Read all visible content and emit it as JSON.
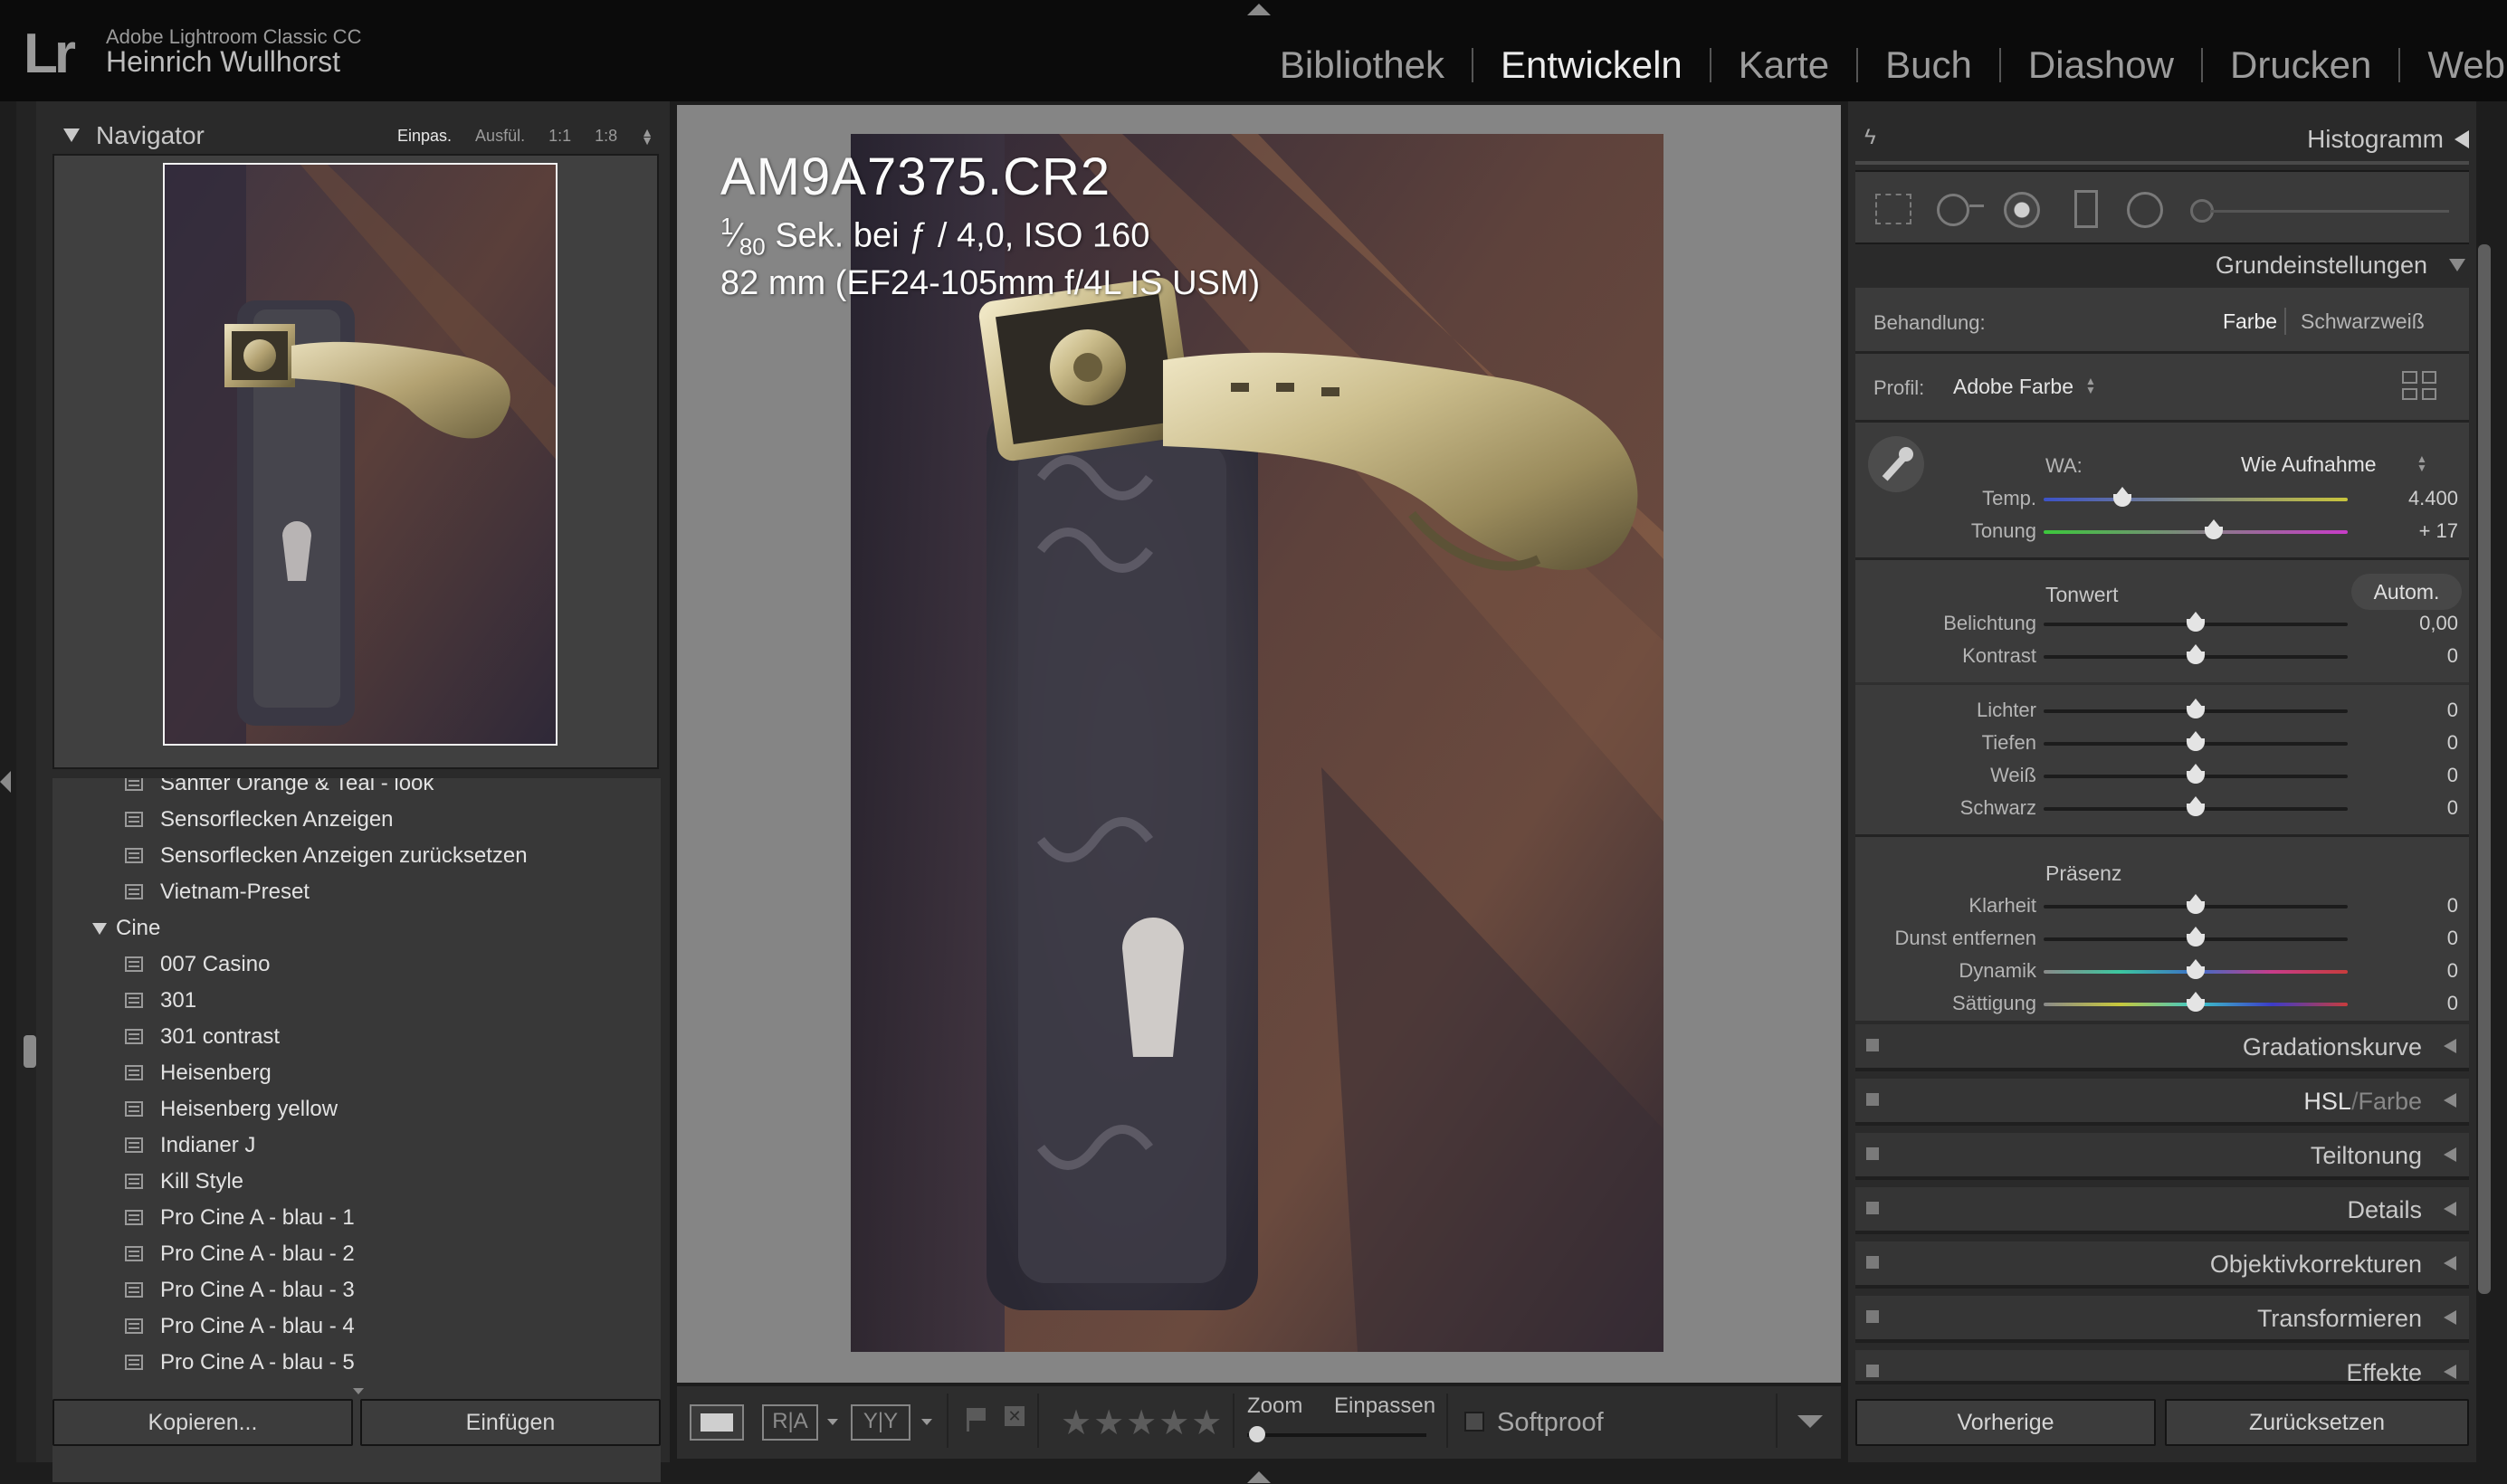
{
  "app": {
    "title": "Adobe Lightroom Classic CC",
    "user": "Heinrich Wullhorst",
    "logo": "Lr"
  },
  "modules": [
    "Bibliothek",
    "Entwickeln",
    "Karte",
    "Buch",
    "Diashow",
    "Drucken",
    "Web"
  ],
  "active_module": "Entwickeln",
  "navigator": {
    "title": "Navigator",
    "zooms": [
      "Einpas.",
      "Ausfül.",
      "1:1",
      "1:8"
    ],
    "selected_zoom": "Einpas."
  },
  "presets": {
    "items": [
      {
        "label": "Sanfter Orange & Teal - look",
        "type": "preset"
      },
      {
        "label": "Sensorflecken Anzeigen",
        "type": "preset"
      },
      {
        "label": "Sensorflecken Anzeigen zurücksetzen",
        "type": "preset"
      },
      {
        "label": "Vietnam-Preset",
        "type": "preset"
      },
      {
        "label": "Cine",
        "type": "folder"
      },
      {
        "label": "007 Casino",
        "type": "preset"
      },
      {
        "label": "301",
        "type": "preset"
      },
      {
        "label": "301 contrast",
        "type": "preset"
      },
      {
        "label": "Heisenberg",
        "type": "preset"
      },
      {
        "label": "Heisenberg yellow",
        "type": "preset"
      },
      {
        "label": "Indianer J",
        "type": "preset"
      },
      {
        "label": "Kill Style",
        "type": "preset"
      },
      {
        "label": "Pro Cine A - blau - 1",
        "type": "preset"
      },
      {
        "label": "Pro Cine A - blau - 2",
        "type": "preset"
      },
      {
        "label": "Pro Cine A - blau - 3",
        "type": "preset"
      },
      {
        "label": "Pro Cine A - blau - 4",
        "type": "preset"
      },
      {
        "label": "Pro Cine A - blau - 5",
        "type": "preset"
      }
    ]
  },
  "left_buttons": {
    "copy": "Kopieren...",
    "paste": "Einfügen"
  },
  "photo_info": {
    "filename": "AM9A7375.CR2",
    "exposure_num": "1",
    "exposure_den": "80",
    "exposure_rest": "Sek. bei ƒ / 4,0, ISO 160",
    "lens": "82 mm (EF24-105mm f/4L IS USM)"
  },
  "toolbar": {
    "zoom_label": "Zoom",
    "fit_label": "Einpassen",
    "softproof_label": "Softproof",
    "compare_ra": "R|A",
    "compare_yy": "Y|Y",
    "rating": 0
  },
  "right_panel": {
    "histogram_title": "Histogramm",
    "basic_title": "Grundeinstellungen",
    "treatment_label": "Behandlung:",
    "treatment_options": [
      "Farbe",
      "Schwarzweiß"
    ],
    "treatment_selected": "Farbe",
    "profile_label": "Profil:",
    "profile_value": "Adobe Farbe",
    "wb_label": "WA:",
    "wb_value": "Wie Aufnahme",
    "tone_title": "Tonwert",
    "auto_label": "Autom.",
    "presence_title": "Präsenz",
    "sliders": {
      "temp": {
        "label": "Temp.",
        "value": "4.400",
        "pos": 0.26
      },
      "tint": {
        "label": "Tonung",
        "value": "+ 17",
        "pos": 0.56
      },
      "exposure": {
        "label": "Belichtung",
        "value": "0,00",
        "pos": 0.5
      },
      "contrast": {
        "label": "Kontrast",
        "value": "0",
        "pos": 0.5
      },
      "highlights": {
        "label": "Lichter",
        "value": "0",
        "pos": 0.5
      },
      "shadows": {
        "label": "Tiefen",
        "value": "0",
        "pos": 0.5
      },
      "whites": {
        "label": "Weiß",
        "value": "0",
        "pos": 0.5
      },
      "blacks": {
        "label": "Schwarz",
        "value": "0",
        "pos": 0.5
      },
      "clarity": {
        "label": "Klarheit",
        "value": "0",
        "pos": 0.5
      },
      "dehaze": {
        "label": "Dunst entfernen",
        "value": "0",
        "pos": 0.5
      },
      "vibrance": {
        "label": "Dynamik",
        "value": "0",
        "pos": 0.5
      },
      "saturation": {
        "label": "Sättigung",
        "value": "0",
        "pos": 0.5
      }
    },
    "collapsed_panels": [
      "Gradationskurve",
      "HSL / Farbe",
      "Teiltonung",
      "Details",
      "Objektivkorrekturen",
      "Transformieren",
      "Effekte"
    ],
    "hsl_part1": "HSL",
    "hsl_part2": "/",
    "hsl_part3": "Farbe",
    "buttons": {
      "previous": "Vorherige",
      "reset": "Zurücksetzen"
    }
  },
  "colors": {
    "accent": "#ececec",
    "panel_bg": "#2a2a2a",
    "topbar_bg": "#0b0b0b",
    "canvas_bg": "#858585"
  }
}
